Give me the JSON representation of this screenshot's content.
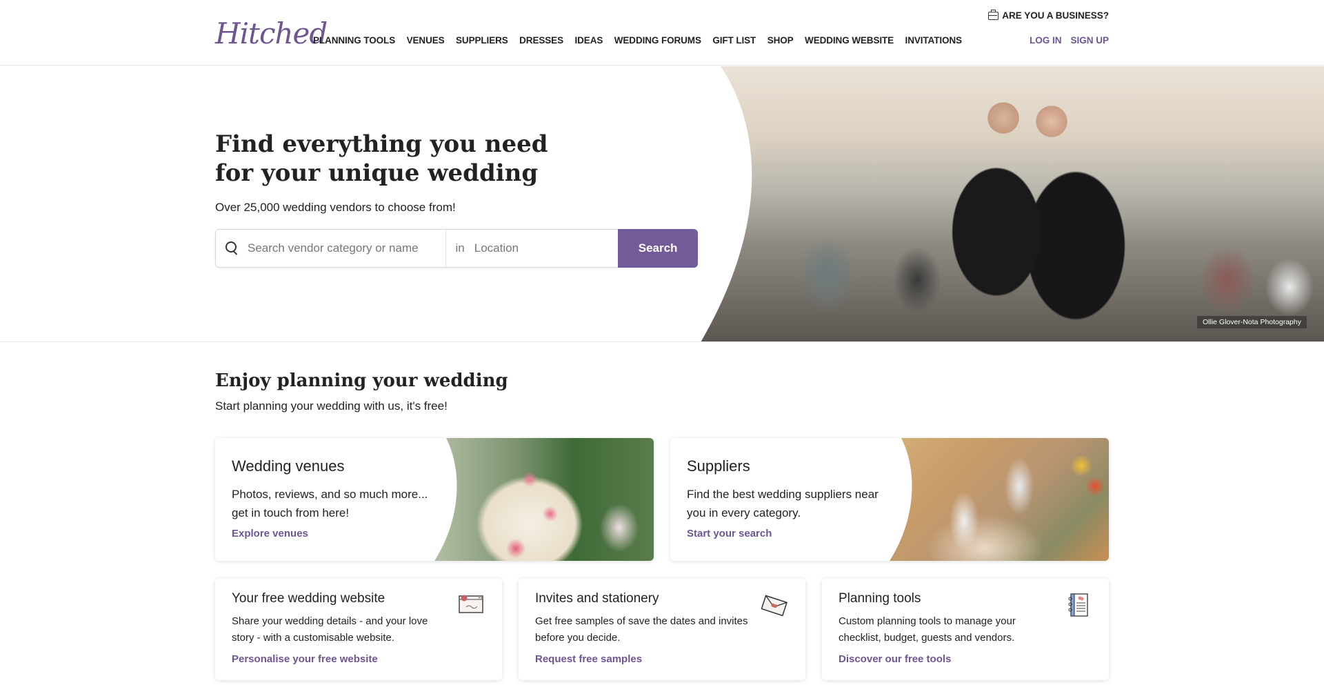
{
  "header": {
    "logo": "Hitched",
    "nav": [
      "PLANNING TOOLS",
      "VENUES",
      "SUPPLIERS",
      "DRESSES",
      "IDEAS",
      "WEDDING FORUMS",
      "GIFT LIST",
      "SHOP",
      "WEDDING WEBSITE",
      "INVITATIONS"
    ],
    "business_link": "ARE YOU A BUSINESS?",
    "business_icon": "briefcase-icon",
    "login": "LOG IN",
    "signup": "SIGN UP"
  },
  "hero": {
    "title": "Find everything you need for your unique wedding",
    "subtitle": "Over 25,000 wedding vendors to choose from!",
    "search": {
      "icon": "search-icon",
      "placeholder": "Search vendor category or name",
      "value": "",
      "location_prefix": "in",
      "location_placeholder": "Location",
      "location_value": "",
      "button": "Search"
    },
    "photo_credit": "Ollie Glover-Nota Photography"
  },
  "section": {
    "title": "Enjoy planning your wedding",
    "subtitle": "Start planning your wedding with us, it's free!"
  },
  "big_cards": [
    {
      "title": "Wedding venues",
      "text": "Photos, reviews, and so much more... get in touch from here!",
      "link": "Explore venues"
    },
    {
      "title": "Suppliers",
      "text": "Find the best wedding suppliers near you in every category.",
      "link": "Start your search"
    }
  ],
  "small_cards": [
    {
      "title": "Your free wedding website",
      "text": "Share your wedding details - and your love story - with a customisable website.",
      "link": "Personalise your free website",
      "icon": "website-icon"
    },
    {
      "title": "Invites and stationery",
      "text": "Get free samples of save the dates and invites before you decide.",
      "link": "Request free samples",
      "icon": "envelope-icon"
    },
    {
      "title": "Planning tools",
      "text": "Custom planning tools to manage your checklist, budget, guests and vendors.",
      "link": "Discover our free tools",
      "icon": "notebook-icon"
    }
  ],
  "colors": {
    "brand": "#735a98",
    "link": "#6f5592",
    "text": "#222222"
  }
}
